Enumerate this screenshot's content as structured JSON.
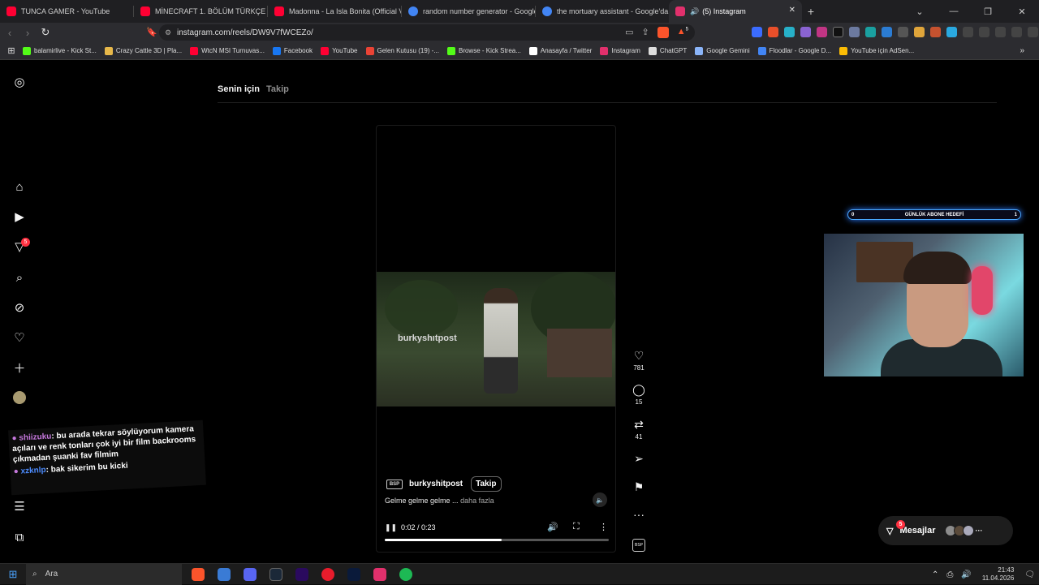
{
  "tabs": [
    {
      "title": "TUNCA GAMER - YouTube",
      "color": "#ff0033"
    },
    {
      "title": "MİNECRAFT 1. BÖLÜM TÜRKÇE - You",
      "color": "#ff0033"
    },
    {
      "title": "Madonna - La Isla Bonita (Official Vid",
      "color": "#ff0033"
    },
    {
      "title": "random number generator - Google",
      "color": "#4285f4"
    },
    {
      "title": "the mortuary assistant - Google'da A",
      "color": "#4285f4"
    },
    {
      "title": "(5) Instagram",
      "color": "#e1306c",
      "sound": "🔊"
    }
  ],
  "address": {
    "url": "instagram.com/reels/DW9V7fWCEZo/"
  },
  "brave_badge": "5",
  "bookmarks": [
    "balamirlive - Kick St...",
    "Crazy Cattle 3D | Pla...",
    "WtcN MSI Turnuvas...",
    "Facebook",
    "YouTube",
    "Gelen Kutusu (19) -...",
    "Browse - Kick Strea...",
    "Anasayfa / Twitter",
    "Instagram",
    "ChatGPT",
    "Google Gemini",
    "Floodlar - Google D...",
    "YouTube için AdSen..."
  ],
  "bookmark_colors": [
    "#53fc18",
    "#e7b84a",
    "#ff0033",
    "#1877f2",
    "#ff0033",
    "#ea4335",
    "#53fc18",
    "#ffffff",
    "#e1306c",
    "#dddddd",
    "#8ab4f8",
    "#4285f4",
    "#fbbc04"
  ],
  "left_nav": {
    "notifications_badge": "5"
  },
  "feed_tabs": {
    "selected": "Senin için",
    "other": "Takip"
  },
  "reel": {
    "watermark": "burkyshıtpost",
    "author": "burkyshitpost",
    "logo_text": "BSP",
    "follow_label": "Takip",
    "caption": "Gelme gelme gelme ...",
    "more_label": "daha fazla",
    "time": "0:02 / 0:23",
    "progress": 0.52
  },
  "actions": {
    "likes": "781",
    "comments": "15",
    "reposts": "41"
  },
  "overlay": {
    "goal_left": "0",
    "goal_label": "GÜNLÜK ABONE HEDEFİ",
    "goal_right": "1",
    "chat": [
      {
        "user": "shiizuku",
        "text": ": bu arada tekrar söylüyorum kamera açıları ve renk tonları çok iyi bir film backrooms çıkmadan şuanki fav filmim"
      },
      {
        "user": "xzknlp",
        "text": ": bak sikerim bu kicki"
      }
    ]
  },
  "messages": {
    "label": "Mesajlar",
    "badge": "5"
  },
  "taskbar": {
    "search_placeholder": "Ara",
    "time": "21:43",
    "date": "11.04.2026"
  }
}
